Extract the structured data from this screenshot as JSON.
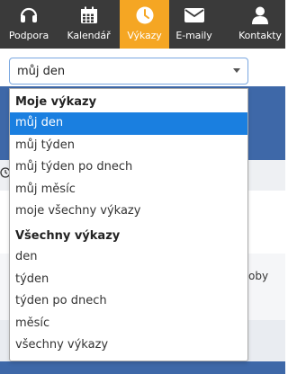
{
  "nav": {
    "items": [
      {
        "label": "Podpora",
        "icon": "headset-icon"
      },
      {
        "label": "Kalendář",
        "icon": "calendar-icon"
      },
      {
        "label": "Výkazy",
        "icon": "clock-icon",
        "active": true
      },
      {
        "label": "E-maily",
        "icon": "envelope-icon"
      },
      {
        "label": "Kontakty",
        "icon": "person-icon"
      }
    ]
  },
  "select": {
    "value": "můj den"
  },
  "dropdown": {
    "groups": [
      {
        "label": "Moje výkazy",
        "options": [
          "můj den",
          "můj týden",
          "můj týden po dnech",
          "můj měsíc",
          "moje všechny výkazy"
        ]
      },
      {
        "label": "Všechny výkazy",
        "options": [
          "den",
          "týden",
          "týden po dnech",
          "měsíc",
          "všechny výkazy"
        ]
      }
    ]
  },
  "background": {
    "partial_text": "oby"
  },
  "colors": {
    "nav_bg": "#3a3a3a",
    "nav_active": "#f5a623",
    "selected_option": "#1a7fe0",
    "page_blue": "#3e68a8"
  }
}
